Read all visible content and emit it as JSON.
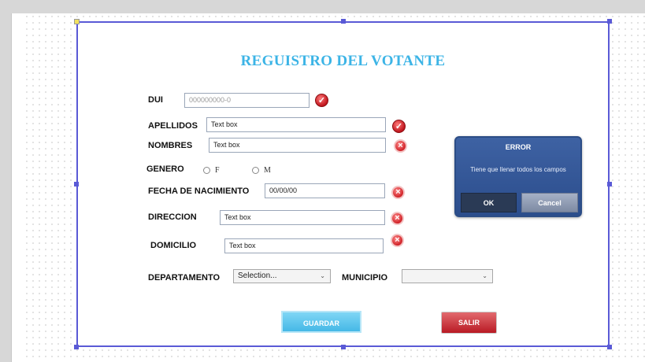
{
  "form": {
    "title": "REGUISTRO DEL VOTANTE",
    "dui": {
      "label": "DUI",
      "placeholder": "000000000-0",
      "status": "check-icon"
    },
    "apellidos": {
      "label": "APELLIDOS",
      "value": "Text box",
      "status": "check-icon"
    },
    "nombres": {
      "label": "NOMBRES",
      "value": "Text box",
      "status": "error-icon"
    },
    "genero": {
      "label": "GENERO",
      "options": [
        "F",
        "M"
      ]
    },
    "fecha": {
      "label": "FECHA DE NACIMIENTO",
      "value": "00/00/00",
      "status": "error-icon"
    },
    "direccion": {
      "label": "DIRECCION",
      "value": "Text box",
      "status": "error-icon"
    },
    "domicilio": {
      "label": "DOMICILIO",
      "value": "Text box",
      "status": "error-icon"
    },
    "departamento": {
      "label": "DEPARTAMENTO",
      "selected": "Selection..."
    },
    "municipio": {
      "label": "MUNICIPIO",
      "selected": ""
    },
    "buttons": {
      "guardar": "GUARDAR",
      "salir": "SALIR"
    }
  },
  "dialog": {
    "title": "ERROR",
    "message": "Tiene que llenar todos los campos",
    "ok": "OK",
    "cancel": "Cancel"
  },
  "colors": {
    "title": "#3cb4e6",
    "selection_border": "#5a5ad6",
    "guardar": "#45b8e6",
    "salir": "#b91a24",
    "dialog": "#2b4d8c"
  }
}
